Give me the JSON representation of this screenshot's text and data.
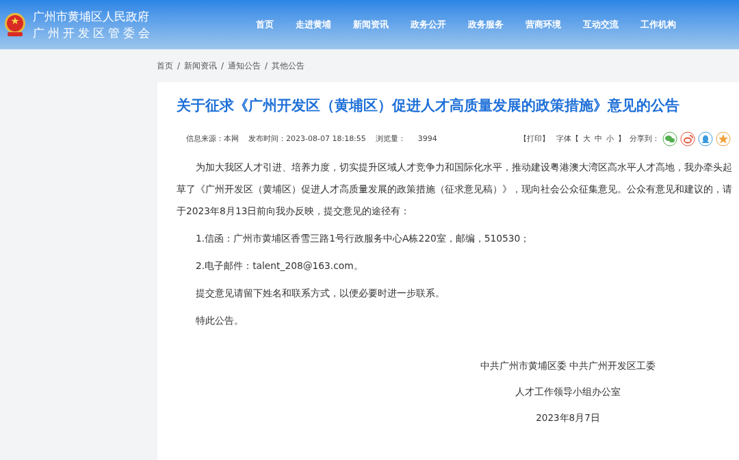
{
  "header": {
    "title_line_1": "广州市黄埔区人民政府",
    "title_line_2": "广州开发区管委会",
    "nav": [
      {
        "label": "首页"
      },
      {
        "label": "走进黄埔"
      },
      {
        "label": "新闻资讯"
      },
      {
        "label": "政务公开"
      },
      {
        "label": "政务服务"
      },
      {
        "label": "营商环境"
      },
      {
        "label": "互动交流"
      },
      {
        "label": "工作机构"
      }
    ]
  },
  "breadcrumb": {
    "separator": "/",
    "items": [
      "首页",
      "新闻资讯",
      "通知公告",
      "其他公告"
    ]
  },
  "article": {
    "title": "关于征求《广州开发区（黄埔区）促进人才高质量发展的政策措施》意见的公告",
    "meta": {
      "source": "信息来源：本网",
      "published": "发布时间：2023-08-07 18:18:55",
      "views_label": "浏览量：",
      "views": "3994",
      "print": "【打印】",
      "font_label": "字体【",
      "font_sizes": [
        "大",
        "中",
        "小"
      ],
      "font_close": "】",
      "share_label": "分享到："
    },
    "paragraphs": [
      "为加大我区人才引进、培养力度，切实提升区域人才竞争力和国际化水平，推动建设粤港澳大湾区高水平人才高地，我办牵头起草了《广州开发区（黄埔区）促进人才高质量发展的政策措施（征求意见稿）》，现向社会公众征集意见。公众有意见和建议的，请于2023年8月13日前向我办反映，提交意见的途径有：",
      "1.信函：广州市黄埔区香雪三路1号行政服务中心A栋220室，邮编，510530；",
      "2.电子邮件：talent_208@163.com。",
      "提交意见请留下姓名和联系方式，以便必要时进一步联系。",
      "特此公告。"
    ],
    "signature": [
      "中共广州市黄埔区委 中共广州开发区工委",
      "人才工作领导小组办公室",
      "2023年8月7日"
    ]
  }
}
